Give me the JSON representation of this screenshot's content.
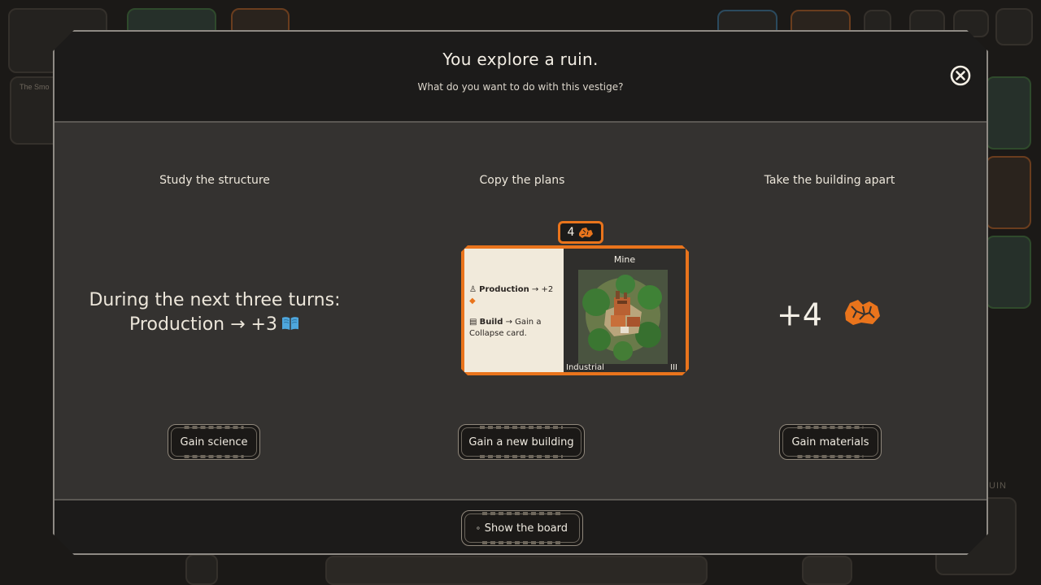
{
  "background": {
    "note_text": "The Smo",
    "ruin_label": "RUIN"
  },
  "dialog": {
    "title": "You explore a ruin.",
    "subtitle": "What do you want to do with this vestige?",
    "close_icon": "close-circle-icon"
  },
  "options": [
    {
      "heading": "Study the structure",
      "effect_line1": "During the next three turns:",
      "effect_line2": "Production → +3",
      "effect_icon": "book-icon",
      "button_label": "Gain science"
    },
    {
      "heading": "Copy the plans",
      "button_label": "Gain a new building",
      "card": {
        "cost": "4",
        "name": "Mine",
        "category": "Industrial",
        "tier": "III",
        "effect_production_keyword": "Production",
        "effect_production_value": "→ +2",
        "effect_build_keyword": "Build",
        "effect_build_text": "→ Gain a Collapse card."
      }
    },
    {
      "heading": "Take the building apart",
      "gain_value": "+4",
      "gain_icon": "materials-icon",
      "button_label": "Gain materials"
    }
  ],
  "footer": {
    "show_board_label": "Show the board",
    "show_board_icon": "close-circle-icon"
  },
  "colors": {
    "accent_orange": "#e9741c",
    "science_blue": "#4ea6dc"
  }
}
